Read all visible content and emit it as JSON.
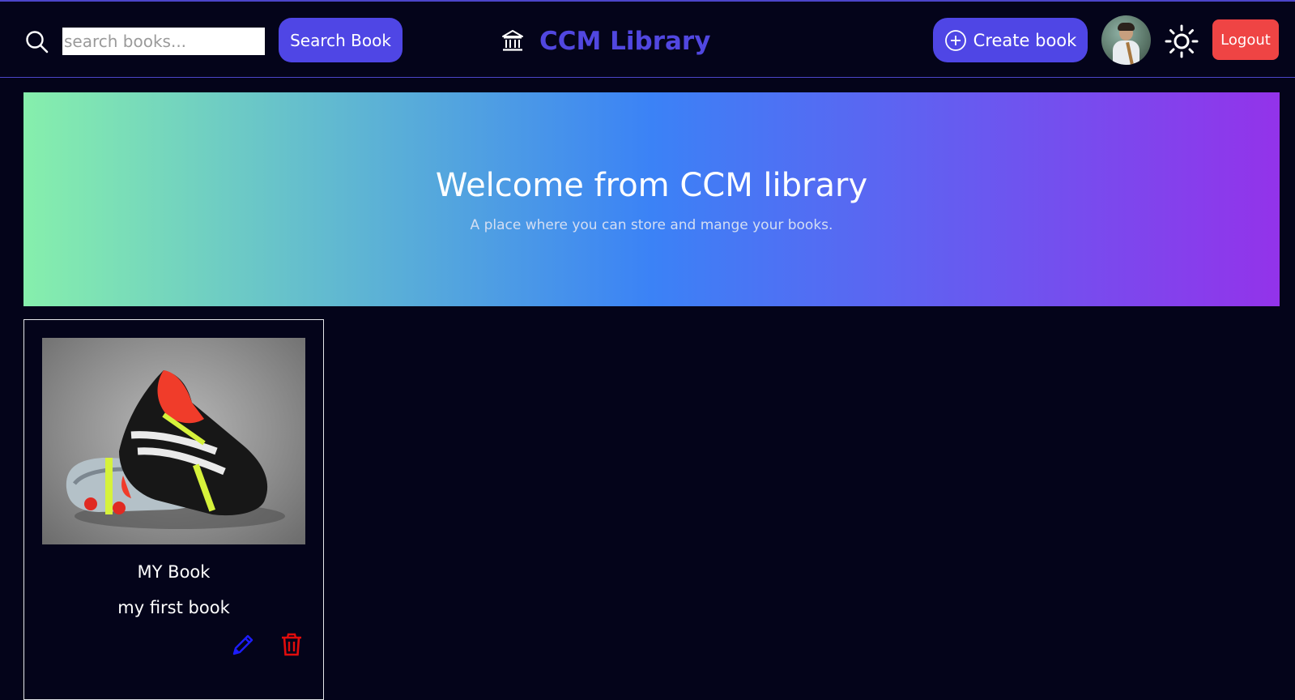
{
  "header": {
    "search_placeholder": "search books...",
    "search_button_label": "Search Book",
    "brand_title": "CCM Library",
    "create_button_label": "Create book",
    "logout_label": "Logout",
    "icons": {
      "search": "search-icon",
      "brand": "library-building-icon",
      "create": "plus-circle-icon",
      "theme": "sun-icon"
    }
  },
  "hero": {
    "title": "Welcome from CCM library",
    "subtitle": "A place where you can store and mange your books."
  },
  "books": [
    {
      "title": "MY Book",
      "description": "my first book",
      "image": "book-cover-image",
      "actions": {
        "edit": "pencil-icon",
        "delete": "trash-icon"
      }
    }
  ],
  "colors": {
    "background": "#04041a",
    "accent": "#4f46e5",
    "brand_text": "#5147e0",
    "danger": "#ef4444",
    "edit_icon": "#1d1dff",
    "delete_icon": "#e10c0c",
    "hero_gradient": [
      "#86efac",
      "#3b82f6",
      "#9333ea"
    ]
  }
}
